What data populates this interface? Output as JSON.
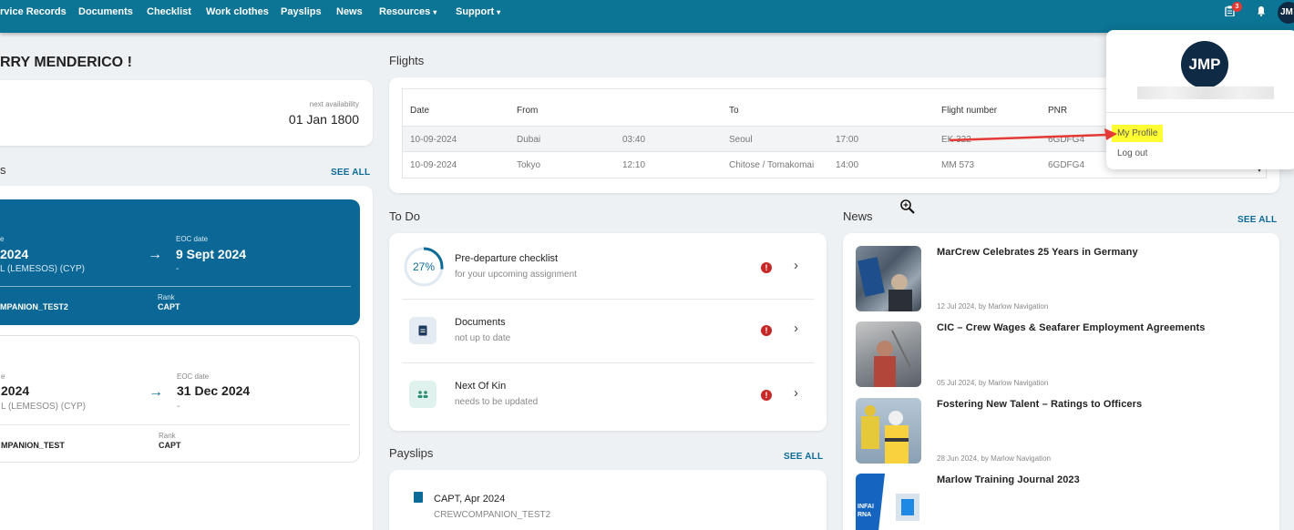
{
  "nav": {
    "items": [
      {
        "label": "rvice Records",
        "has_caret": false
      },
      {
        "label": "Documents",
        "has_caret": false
      },
      {
        "label": "Checklist",
        "has_caret": false
      },
      {
        "label": "Work clothes",
        "has_caret": false
      },
      {
        "label": "Payslips",
        "has_caret": false
      },
      {
        "label": "News",
        "has_caret": false
      },
      {
        "label": "Resources",
        "has_caret": true
      },
      {
        "label": "Support",
        "has_caret": true
      }
    ],
    "caret": "▾",
    "notification_count": "3",
    "avatar_initials": "JM",
    "colors": {
      "bar": "#0c7494",
      "avatar": "#0f2a44"
    }
  },
  "greeting": "RRY MENDERICO !",
  "availability": {
    "label": "next availability",
    "date": "01 Jan 1800"
  },
  "contracts": {
    "title": "s",
    "see_all": "SEE ALL",
    "items": [
      {
        "start_label": "e",
        "start_date": "2024",
        "port": "L (LEMESOS) (CYP)",
        "eoc_label": "EOC date",
        "eoc_date": "9 Sept 2024",
        "eoc_sub": "-",
        "vessel": "MPANION_TEST2",
        "rank_label": "Rank",
        "rank": "CAPT",
        "active": true
      },
      {
        "start_label": "e",
        "start_date": "2024",
        "port": "L (LEMESOS) (CYP)",
        "eoc_label": "EOC date",
        "eoc_date": "31 Dec 2024",
        "eoc_sub": "-",
        "vessel": "MPANION_TEST",
        "rank_label": "Rank",
        "rank": "CAPT",
        "active": false
      }
    ],
    "arrow": "→"
  },
  "flights": {
    "title": "Flights",
    "headers": [
      "Date",
      "From",
      "To",
      "Flight number",
      "PNR"
    ],
    "rows": [
      {
        "date": "10-09-2024",
        "from": "Dubai",
        "dep": "03:40",
        "to": "Seoul",
        "arr": "17:00",
        "flight": "EK 322",
        "pnr": "6GDFG4"
      },
      {
        "date": "10-09-2024",
        "from": "Tokyo",
        "dep": "12:10",
        "to": "Chitose / Tomakomai",
        "arr": "14:00",
        "flight": "MM 573",
        "pnr": "6GDFG4"
      }
    ]
  },
  "todo": {
    "title": "To Do",
    "items": [
      {
        "title": "Pre-departure checklist",
        "sub": "for your upcoming assignment",
        "progress": "27%"
      },
      {
        "title": "Documents",
        "sub": "not up to date"
      },
      {
        "title": "Next Of Kin",
        "sub": "needs to be updated"
      }
    ],
    "alert": "!",
    "chevron": "›"
  },
  "payslips": {
    "title": "Payslips",
    "see_all": "SEE ALL",
    "items": [
      {
        "title": "CAPT, Apr 2024",
        "sub": "CREWCOMPANION_TEST2"
      }
    ]
  },
  "news": {
    "title": "News",
    "see_all": "SEE ALL",
    "items": [
      {
        "title": "MarCrew Celebrates 25 Years in Germany",
        "meta": "12 Jul 2024, by Marlow Navigation"
      },
      {
        "title": "CIC – Crew Wages & Seafarer Employment Agreements",
        "meta": "05 Jul 2024, by Marlow Navigation"
      },
      {
        "title": "Fostering New Talent – Ratings to Officers",
        "meta": "28 Jun 2024, by Marlow Navigation"
      },
      {
        "title": "Marlow Training Journal 2023",
        "meta": ""
      }
    ],
    "thumb_text": "INFAI\nRNA"
  },
  "profile_menu": {
    "initials": "JMP",
    "my_profile": "My Profile",
    "logout": "Log out",
    "highlight_color": "#ffff33"
  }
}
